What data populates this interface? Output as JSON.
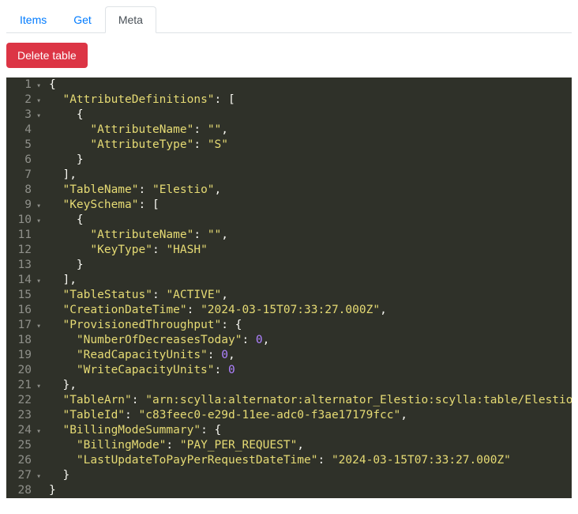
{
  "tabs": [
    {
      "label": "Items",
      "active": false
    },
    {
      "label": "Get",
      "active": false
    },
    {
      "label": "Meta",
      "active": true
    }
  ],
  "toolbar": {
    "delete_label": "Delete table"
  },
  "meta_json": {
    "AttributeDefinitions": [
      {
        "AttributeName": "",
        "AttributeType": "S"
      }
    ],
    "TableName": "Elestio",
    "KeySchema": [
      {
        "AttributeName": "",
        "KeyType": "HASH"
      }
    ],
    "TableStatus": "ACTIVE",
    "CreationDateTime": "2024-03-15T07:33:27.000Z",
    "ProvisionedThroughput": {
      "NumberOfDecreasesToday": 0,
      "ReadCapacityUnits": 0,
      "WriteCapacityUnits": 0
    },
    "TableArn": "arn:scylla:alternator:alternator_Elestio:scylla:table/Elestio",
    "TableId": "c83feec0-e29d-11ee-adc0-f3ae17179fcc",
    "BillingModeSummary": {
      "BillingMode": "PAY_PER_REQUEST",
      "LastUpdateToPayPerRequestDateTime": "2024-03-15T07:33:27.000Z"
    }
  },
  "fold_lines": [
    1,
    2,
    3,
    9,
    10,
    14,
    17,
    21,
    24,
    27
  ]
}
